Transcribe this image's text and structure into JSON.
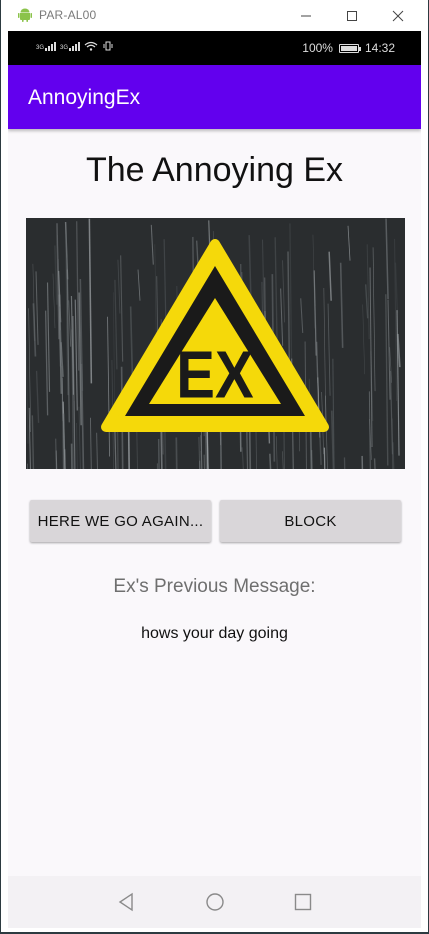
{
  "window": {
    "title": "PAR-AL00",
    "controls": {
      "minimize": "—",
      "maximize": "☐",
      "close": "✕"
    }
  },
  "status_bar": {
    "signal_1": "3G",
    "signal_2": "3G",
    "battery_percent": "100%",
    "battery_level": 1.0,
    "time": "14:32"
  },
  "app_bar": {
    "title": "AnnoyingEx"
  },
  "main": {
    "heading": "The Annoying Ex",
    "hero_image": {
      "icon": "warning-triangle-icon",
      "text": "EX"
    },
    "buttons": {
      "again_label": "HERE WE GO AGAIN...",
      "block_label": "BLOCK"
    },
    "previous_label": "Ex's Previous Message:",
    "previous_message": "hows your day going"
  },
  "nav_bar": {
    "back": "back-icon",
    "home": "home-icon",
    "recents": "recents-icon"
  },
  "colors": {
    "primary": "#6200ee",
    "warning_yellow": "#f5d90a",
    "button_bg": "#d9d6d9"
  }
}
